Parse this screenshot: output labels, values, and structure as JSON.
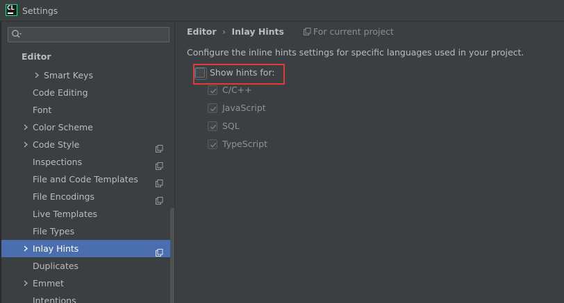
{
  "window": {
    "title": "Settings",
    "app_icon_text": "CL"
  },
  "search": {
    "placeholder": ""
  },
  "sidebar": {
    "header": "Editor",
    "items": [
      {
        "label": "Smart Keys",
        "expandable": true,
        "badge": false,
        "selected": false
      },
      {
        "label": "Code Editing",
        "expandable": false,
        "badge": false,
        "selected": false
      },
      {
        "label": "Font",
        "expandable": false,
        "badge": false,
        "selected": false
      },
      {
        "label": "Color Scheme",
        "expandable": true,
        "badge": false,
        "selected": false
      },
      {
        "label": "Code Style",
        "expandable": true,
        "badge": true,
        "selected": false
      },
      {
        "label": "Inspections",
        "expandable": false,
        "badge": true,
        "selected": false
      },
      {
        "label": "File and Code Templates",
        "expandable": false,
        "badge": true,
        "selected": false
      },
      {
        "label": "File Encodings",
        "expandable": false,
        "badge": true,
        "selected": false
      },
      {
        "label": "Live Templates",
        "expandable": false,
        "badge": false,
        "selected": false
      },
      {
        "label": "File Types",
        "expandable": false,
        "badge": false,
        "selected": false
      },
      {
        "label": "Inlay Hints",
        "expandable": true,
        "badge": true,
        "selected": true
      },
      {
        "label": "Duplicates",
        "expandable": false,
        "badge": false,
        "selected": false
      },
      {
        "label": "Emmet",
        "expandable": true,
        "badge": false,
        "selected": false
      },
      {
        "label": "Intentions",
        "expandable": false,
        "badge": false,
        "selected": false
      }
    ]
  },
  "breadcrumb": {
    "parent": "Editor",
    "separator": "›",
    "current": "Inlay Hints"
  },
  "scope": {
    "label": "For current project",
    "icon": "project-scope-icon"
  },
  "description": "Configure the inline hints settings for specific languages used in your project.",
  "show_hints": {
    "label": "Show hints for:",
    "checked": false
  },
  "languages": [
    {
      "label": "C/C++",
      "checked": true,
      "enabled": false
    },
    {
      "label": "JavaScript",
      "checked": true,
      "enabled": false
    },
    {
      "label": "SQL",
      "checked": true,
      "enabled": false
    },
    {
      "label": "TypeScript",
      "checked": true,
      "enabled": false
    }
  ],
  "colors": {
    "selection": "#4b6eaf",
    "highlight_box": "#e53935",
    "background": "#3c3f41"
  }
}
